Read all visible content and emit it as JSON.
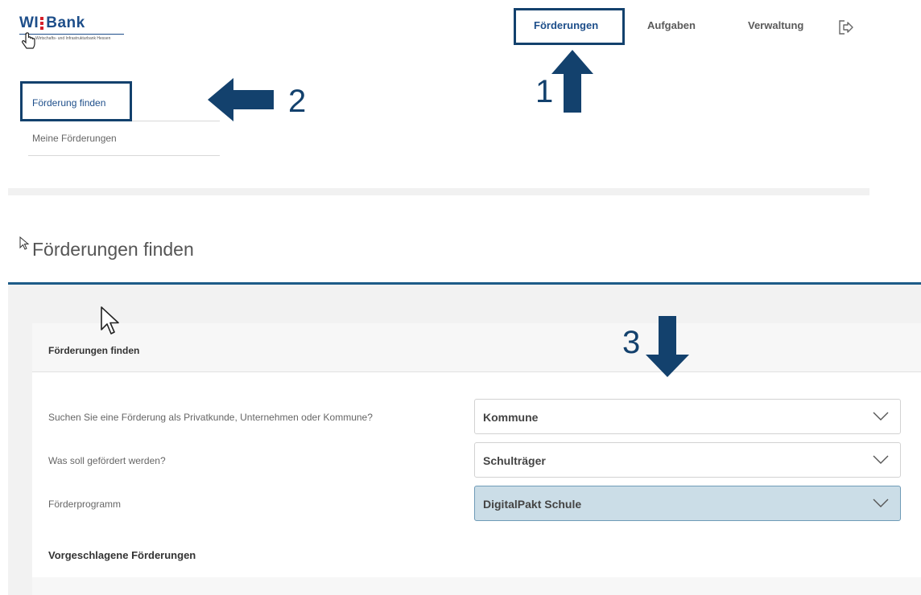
{
  "brand": {
    "logo_text_left": "WI",
    "logo_text_right": "Bank",
    "logo_subtitle": "Wirtschafts- und Infrastrukturbank Hessen",
    "accent": "#13416d",
    "logo_red": "#d6202a"
  },
  "topnav": {
    "items": [
      {
        "label": "Förderungen",
        "active": true
      },
      {
        "label": "Aufgaben",
        "active": false
      },
      {
        "label": "Verwaltung",
        "active": false
      }
    ],
    "logout_icon": "logout-icon"
  },
  "subnav": {
    "items": [
      {
        "label": "Förderung finden",
        "active": true
      },
      {
        "label": "Meine Förderungen",
        "active": false
      }
    ]
  },
  "annotations": {
    "step1": "1",
    "step2": "2",
    "step3": "3"
  },
  "page": {
    "title": "Förderungen finden"
  },
  "card": {
    "title": "Förderungen finden",
    "questions": [
      {
        "label": "Suchen Sie eine Förderung als Privatkunde, Unternehmen oder Kommune?",
        "value": "Kommune"
      },
      {
        "label": "Was soll gefördert werden?",
        "value": "Schulträger"
      },
      {
        "label": "Förderprogramm",
        "value": "DigitalPakt Schule"
      }
    ],
    "suggested_heading": "Vorgeschlagene Förderungen"
  }
}
